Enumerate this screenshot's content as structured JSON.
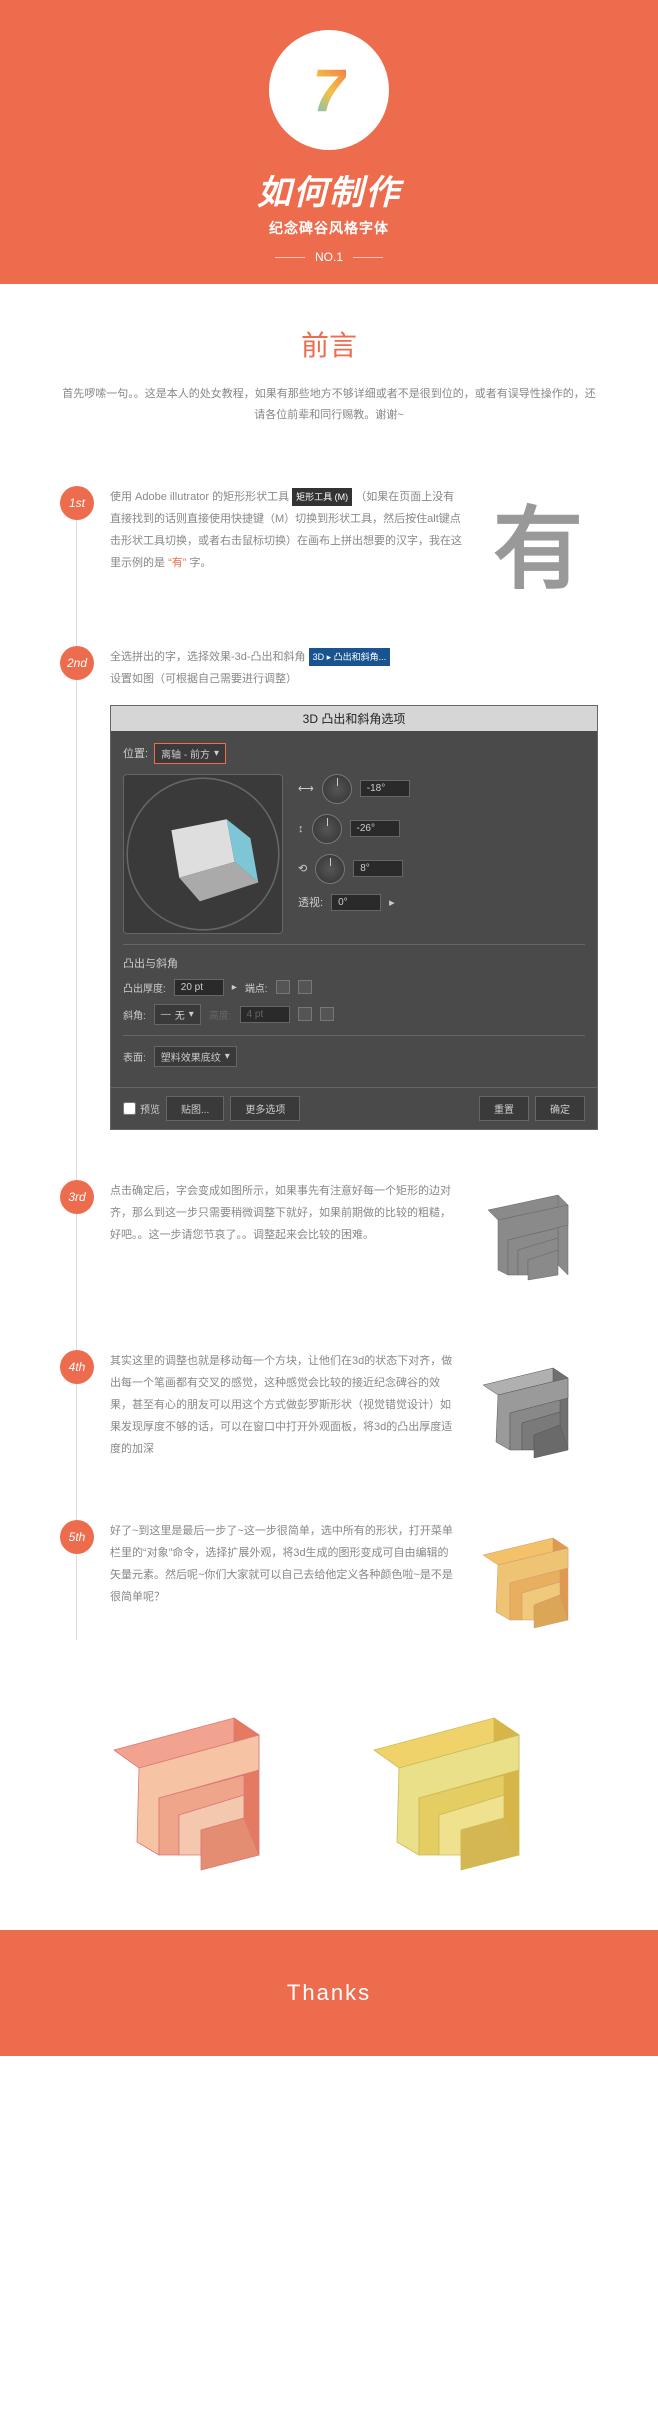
{
  "hero": {
    "logo_text": "7",
    "title": "如何制作",
    "subtitle": "纪念碑谷风格字体",
    "no": "NO.1"
  },
  "preface": {
    "title": "前言",
    "text": "首先啰嗦一句。。这是本人的处女教程，如果有那些地方不够详细或者不是很到位的，或者有误导性操作的，还请各位前辈和同行赐教。谢谢~"
  },
  "steps": [
    {
      "num": "1st",
      "text_a": "使用 Adobe illutrator 的矩形形状工具",
      "tag_a": "矩形工具 (M)",
      "text_b": "（如果在页面上没有直接找到的话则直接使用快捷键（M）切换到形状工具，然后按住alt键点击形状工具切换，或者右击鼠标切换）在画布上拼出想要的汉字，我在这里示例的是",
      "q": "“有”",
      "text_c": "字。"
    },
    {
      "num": "2nd",
      "text_a": "全选拼出的字，选择效果-3d-凸出和斜角",
      "tag_a": "3D ▸ 凸出和斜角...",
      "text_b": "设置如图（可根据自己需要进行调整）"
    },
    {
      "num": "3rd",
      "text": "点击确定后，字会变成如图所示，如果事先有注意好每一个矩形的边对齐，那么到这一步只需要稍微调整下就好，如果前期做的比较的粗糙，好吧。。这一步请您节哀了。。调整起来会比较的困难。"
    },
    {
      "num": "4th",
      "text": "其实这里的调整也就是移动每一个方块，让他们在3d的状态下对齐，做出每一个笔画都有交叉的感觉，这种感觉会比较的接近纪念碑谷的效果，甚至有心的朋友可以用这个方式做彭罗斯形状（视觉错觉设计）如果发现厚度不够的话，可以在窗口中打开外观面板，将3d的凸出厚度适度的加深"
    },
    {
      "num": "5th",
      "text": "好了~到这里是最后一步了~这一步很简单，选中所有的形状，打开菜单栏里的“对象”命令，选择扩展外观，将3d生成的图形变成可自由编辑的矢量元素。然后呢~你们大家就可以自己去给他定义各种颜色啦~是不是很简单呢？"
    }
  ],
  "panel": {
    "title": "3D 凸出和斜角选项",
    "position_label": "位置:",
    "position_value": "离轴 - 前方",
    "angle1": "-18°",
    "angle2": "-26°",
    "angle3": "8°",
    "perspective_label": "透视:",
    "perspective_value": "0°",
    "bevel_section": "凸出与斜角",
    "depth_label": "凸出厚度:",
    "depth_value": "20 pt",
    "cap_label": "端点:",
    "bevel_label": "斜角:",
    "bevel_value": "无",
    "height_label": "高度:",
    "height_value": "4 pt",
    "surface_label": "表面:",
    "surface_value": "塑料效果底纹",
    "preview": "预览",
    "btn_map": "贴图...",
    "btn_more": "更多选项",
    "btn_reset": "重置",
    "btn_ok": "确定"
  },
  "footer": "Thanks"
}
